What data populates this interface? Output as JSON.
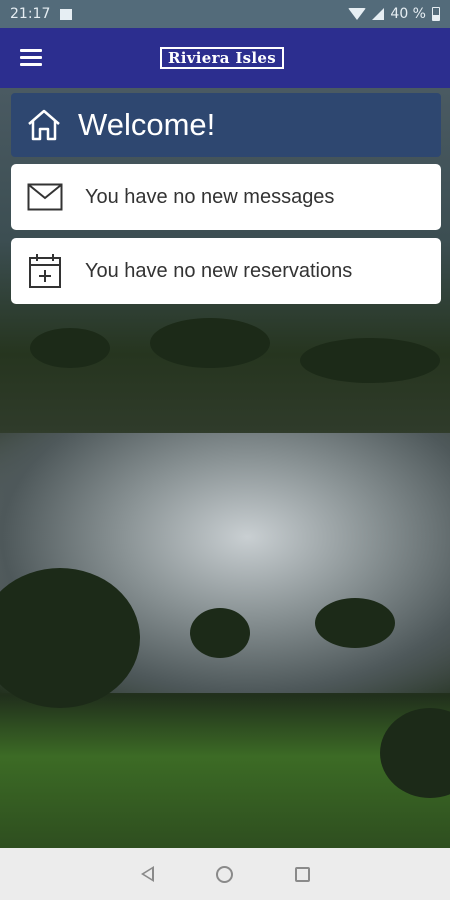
{
  "status_bar": {
    "time": "21:17",
    "battery": "40 %"
  },
  "app_bar": {
    "logo_text": "Riviera Isles"
  },
  "welcome": {
    "title": "Welcome!"
  },
  "cards": {
    "messages": "You have no new messages",
    "reservations": "You have no new reservations"
  },
  "colors": {
    "app_bar": "#2c2e8f",
    "welcome_card": "#2e4770",
    "status_bar": "#536b7a"
  },
  "icons": {
    "menu": "hamburger-menu-icon",
    "home": "home-icon",
    "messages": "mail-icon",
    "reservations": "calendar-add-icon"
  }
}
